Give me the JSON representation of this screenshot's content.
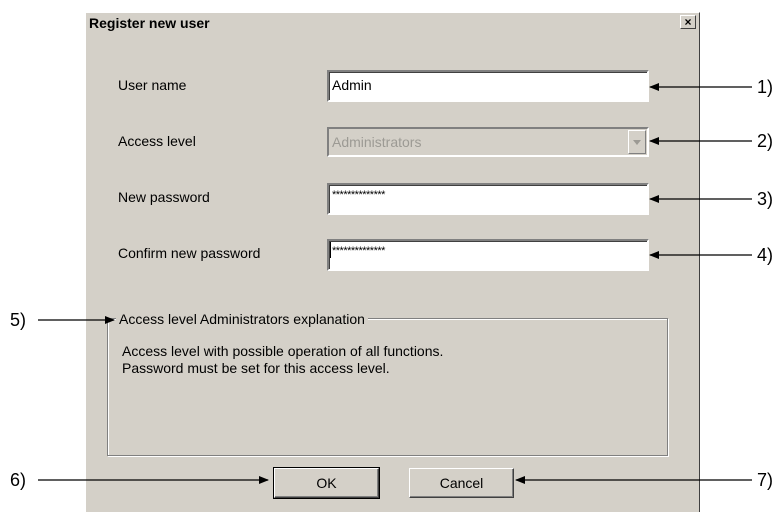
{
  "dialog": {
    "title": "Register new user",
    "close_symbol": "×"
  },
  "form": {
    "user_name": {
      "label": "User name",
      "value": "Admin"
    },
    "access_level": {
      "label": "Access level",
      "value": "Administrators"
    },
    "new_password": {
      "label": "New password",
      "value": "**************"
    },
    "confirm_password": {
      "label": "Confirm new password",
      "value": "**************"
    }
  },
  "explanation": {
    "title": "Access level Administrators explanation",
    "line1": "Access level with possible operation of all functions.",
    "line2": "Password must be set for this access level."
  },
  "buttons": {
    "ok": "OK",
    "cancel": "Cancel"
  },
  "callouts": {
    "c1": "1)",
    "c2": "2)",
    "c3": "3)",
    "c4": "4)",
    "c5": "5)",
    "c6": "6)",
    "c7": "7)"
  }
}
